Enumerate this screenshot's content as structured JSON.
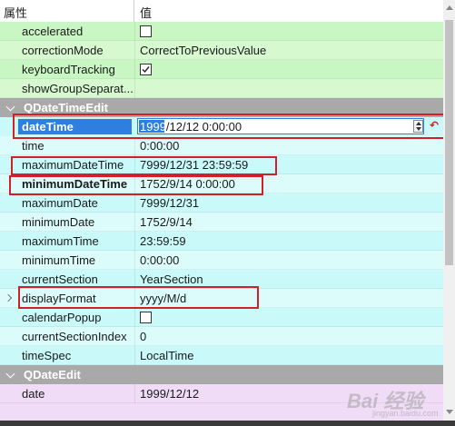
{
  "header": {
    "col_property": "属性",
    "col_value": "值"
  },
  "rows_top": [
    {
      "name": "accelerated",
      "type": "checkbox",
      "checked": false
    },
    {
      "name": "correctionMode",
      "type": "text",
      "value": "CorrectToPreviousValue"
    },
    {
      "name": "keyboardTracking",
      "type": "checkbox",
      "checked": true
    },
    {
      "name": "showGroupSeparat...",
      "type": "text",
      "value": ""
    }
  ],
  "group_datetime": {
    "label": "QDateTimeEdit"
  },
  "editor": {
    "name": "dateTime",
    "value_selected": "1999",
    "value_rest": "/12/12 0:00:00",
    "reset_glyph": "↶"
  },
  "rows_datetime": [
    {
      "name": "time",
      "value": "0:00:00"
    },
    {
      "name": "maximumDateTime",
      "value": "7999/12/31 23:59:59"
    },
    {
      "name": "minimumDateTime",
      "value": "1752/9/14 0:00:00",
      "bold": true
    },
    {
      "name": "maximumDate",
      "value": "7999/12/31"
    },
    {
      "name": "minimumDate",
      "value": "1752/9/14"
    },
    {
      "name": "maximumTime",
      "value": "23:59:59"
    },
    {
      "name": "minimumTime",
      "value": "0:00:00"
    },
    {
      "name": "currentSection",
      "value": "YearSection"
    },
    {
      "name": "displayFormat",
      "value": "yyyy/M/d",
      "expandable": true
    },
    {
      "name": "calendarPopup",
      "type": "checkbox",
      "checked": false
    },
    {
      "name": "currentSectionIndex",
      "value": "0"
    },
    {
      "name": "timeSpec",
      "value": "LocalTime"
    }
  ],
  "group_date": {
    "label": "QDateEdit"
  },
  "rows_date": [
    {
      "name": "date",
      "value": "1999/12/12"
    }
  ],
  "watermark": {
    "logo": "Bai 经验",
    "url": "jingyan.baidu.com"
  },
  "colors": {
    "green": "#c9f7c3",
    "cyan": "#c9f9f9",
    "pink": "#f1dcf7",
    "group": "#a9a9a9",
    "selection": "#2f7fe0",
    "annotation": "#d21f2a"
  }
}
